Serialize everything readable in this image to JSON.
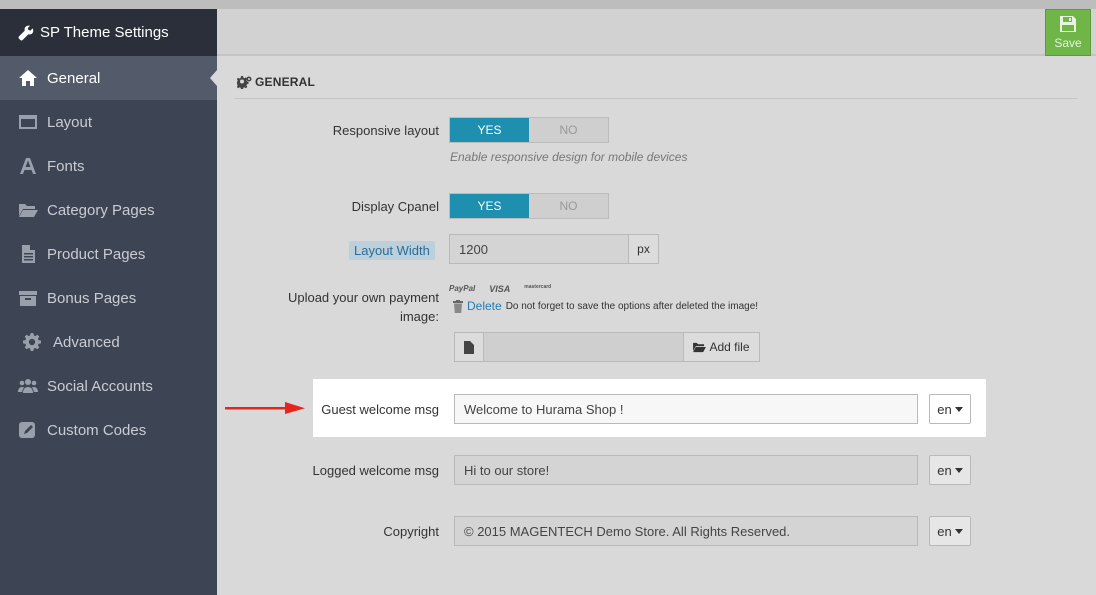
{
  "app": {
    "sidebar_title": "SP Theme Settings",
    "save_label": "Save"
  },
  "sidebar": {
    "items": [
      {
        "label": "General",
        "icon": "home-icon",
        "active": true
      },
      {
        "label": "Layout",
        "icon": "layout-icon"
      },
      {
        "label": "Fonts",
        "icon": "font-icon"
      },
      {
        "label": "Category Pages",
        "icon": "folder-open-icon"
      },
      {
        "label": "Product Pages",
        "icon": "file-icon"
      },
      {
        "label": "Bonus Pages",
        "icon": "archive-icon"
      },
      {
        "label": "Advanced",
        "icon": "gear-icon"
      },
      {
        "label": "Social Accounts",
        "icon": "users-icon"
      },
      {
        "label": "Custom Codes",
        "icon": "edit-icon"
      }
    ]
  },
  "section": {
    "title": "GENERAL"
  },
  "fields": {
    "responsive": {
      "label": "Responsive layout",
      "yes": "YES",
      "no": "NO",
      "help": "Enable responsive design for mobile devices"
    },
    "cpanel": {
      "label": "Display Cpanel",
      "yes": "YES",
      "no": "NO"
    },
    "layout_width": {
      "label": "Layout Width",
      "value": "1200",
      "unit": "px"
    },
    "payment": {
      "label_line1": "Upload your own payment",
      "label_line2": "image:",
      "logos": [
        "PayPal",
        "VISA",
        "mastercard"
      ],
      "delete_label": "Delete",
      "delete_note": "Do not forget to save the options after deleted the image!",
      "add_file_label": "Add file"
    },
    "guest_welcome": {
      "label": "Guest welcome msg",
      "value": "Welcome to Hurama Shop !",
      "lang": "en"
    },
    "logged_welcome": {
      "label": "Logged welcome msg",
      "value": "Hi to our store!",
      "lang": "en"
    },
    "copyright": {
      "label": "Copyright",
      "value": "© 2015 MAGENTECH Demo Store. All Rights Reserved.",
      "lang": "en"
    }
  },
  "colors": {
    "sidebar_bg": "#3d4454",
    "toggle_yes": "#1f8fb0",
    "save_green": "#6fb548",
    "annotation_arrow": "#e8241c"
  }
}
